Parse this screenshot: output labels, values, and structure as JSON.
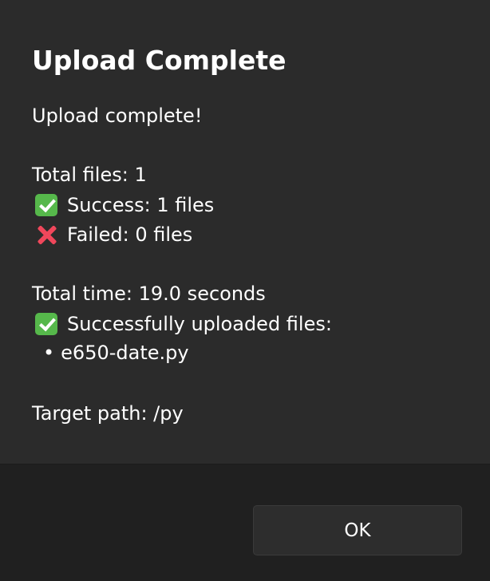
{
  "dialog": {
    "title": "Upload Complete",
    "message": {
      "headline": "Upload complete!",
      "total_files": "Total files: 1",
      "success": "Success: 1 files",
      "failed": "Failed: 0 files",
      "total_time": "Total time: 19.0 seconds",
      "uploaded_heading": "Successfully uploaded files:",
      "files": [
        "e650-date.py"
      ],
      "target_path": "Target path: /py"
    },
    "icons": {
      "success": "check-mark-button-icon",
      "failed": "cross-mark-icon"
    },
    "colors": {
      "check_green": "#56b84b",
      "cross_red": "#f0475b"
    }
  },
  "footer": {
    "ok_label": "OK"
  }
}
